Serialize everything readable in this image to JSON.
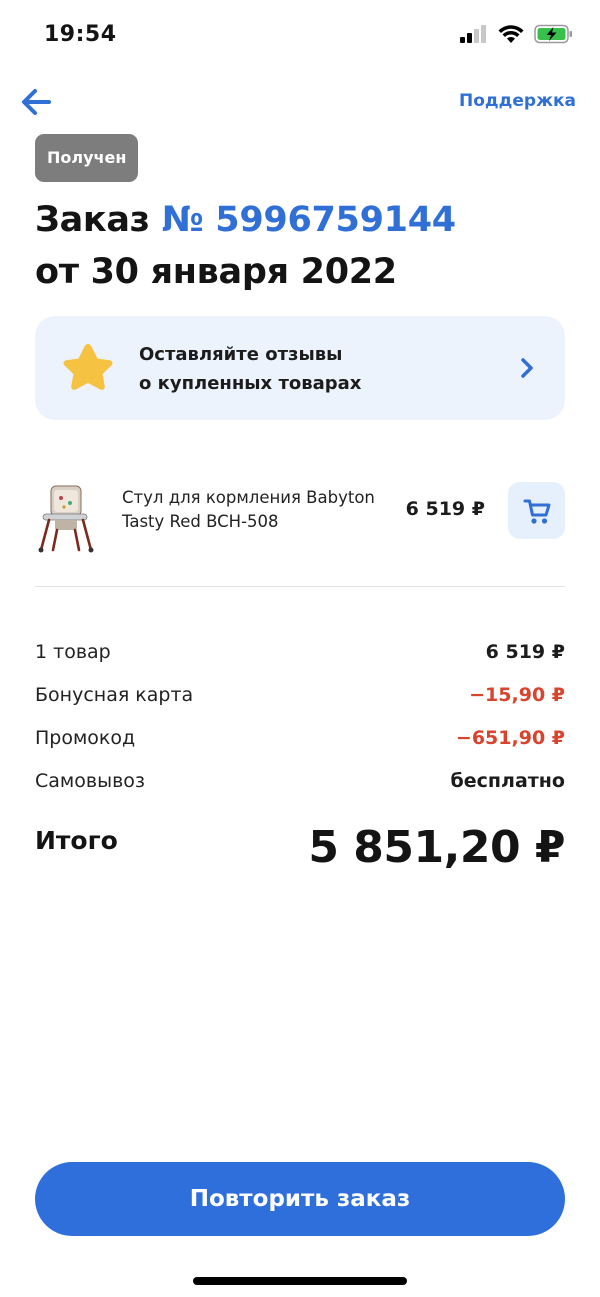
{
  "status_bar": {
    "time": "19:54",
    "icons": [
      "signal-icon",
      "wifi-icon",
      "battery-charging-icon"
    ]
  },
  "nav": {
    "back_icon": "arrow-left-icon",
    "support_label": "Поддержка"
  },
  "order": {
    "status_label": "Получен",
    "title_prefix": "Заказ",
    "number": "№ 5996759144",
    "date": "от 30 января 2022"
  },
  "review_banner": {
    "line1": "Оставляйте отзывы",
    "line2": "о купленных товарах",
    "star_icon": "star-icon",
    "chevron_icon": "chevron-right-icon"
  },
  "product": {
    "name": "Стул для кормления Babyton Tasty Red BCH-508",
    "price": "6 519 ₽",
    "cart_icon": "cart-icon"
  },
  "summary": {
    "rows": [
      {
        "label": "1 товар",
        "value": "6 519 ₽"
      },
      {
        "label": "Бонусная карта",
        "value": "−15,90 ₽"
      },
      {
        "label": "Промокод",
        "value": "−651,90 ₽"
      },
      {
        "label": "Самовывоз",
        "value": "бесплатно"
      }
    ],
    "total_label": "Итого",
    "total_value": "5 851,20 ₽"
  },
  "repeat_button_label": "Повторить заказ",
  "colors": {
    "accent": "#2f6fd6",
    "negative": "#d8442d",
    "badge": "#7d7d7d",
    "banner_bg": "#edf3fc",
    "star": "#f5c242"
  }
}
